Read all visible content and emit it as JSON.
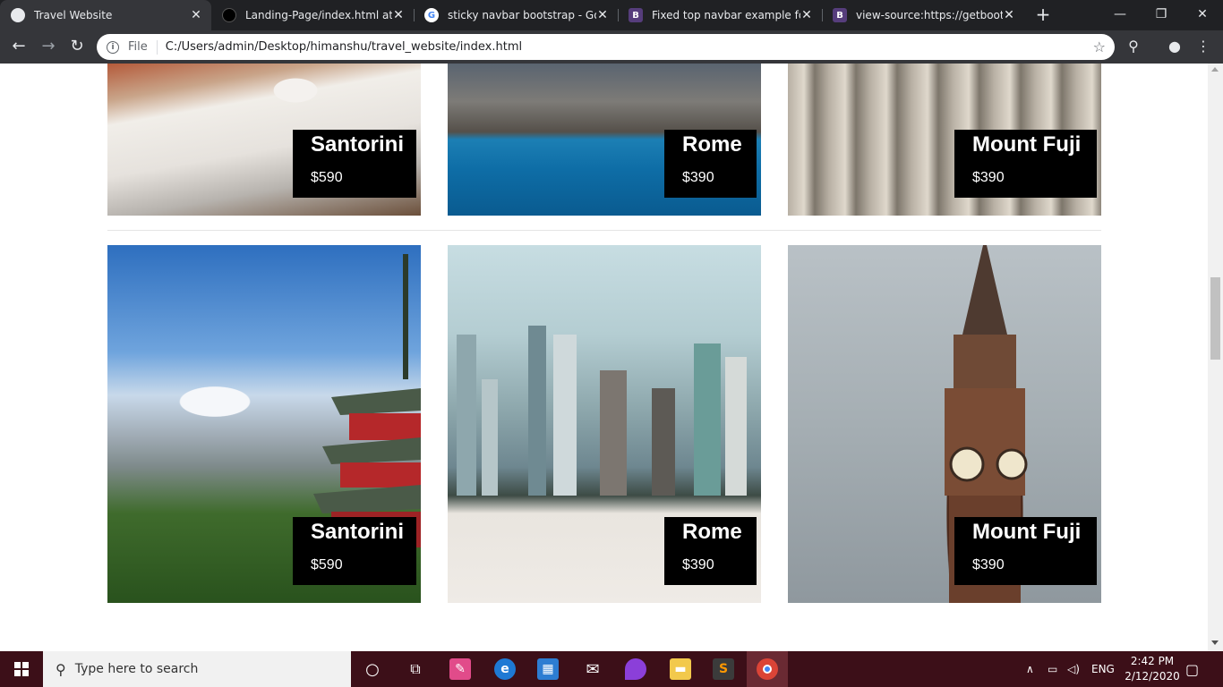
{
  "browser": {
    "tabs": [
      {
        "title": "Travel Website",
        "icon": "globe-icon",
        "active": true
      },
      {
        "title": "Landing-Page/index.html at m",
        "icon": "github-icon",
        "active": false
      },
      {
        "title": "sticky navbar bootstrap - Goo",
        "icon": "google-icon",
        "active": false
      },
      {
        "title": "Fixed top navbar example for B",
        "icon": "bootstrap-icon",
        "active": false
      },
      {
        "title": "view-source:https://getbootstr",
        "icon": "bootstrap-icon",
        "active": false
      }
    ],
    "address": {
      "scheme_label": "File",
      "url": "C:/Users/admin/Desktop/himanshu/travel_website/index.html"
    }
  },
  "destinations_row1": [
    {
      "name": "Santorini",
      "price": "$590"
    },
    {
      "name": "Rome",
      "price": "$390"
    },
    {
      "name": "Mount Fuji",
      "price": "$390"
    }
  ],
  "destinations_row2": [
    {
      "name": "Santorini",
      "price": "$590"
    },
    {
      "name": "Rome",
      "price": "$390"
    },
    {
      "name": "Mount Fuji",
      "price": "$390"
    }
  ],
  "taskbar": {
    "search_placeholder": "Type here to search",
    "language": "ENG",
    "time": "2:42 PM",
    "date": "2/12/2020"
  }
}
